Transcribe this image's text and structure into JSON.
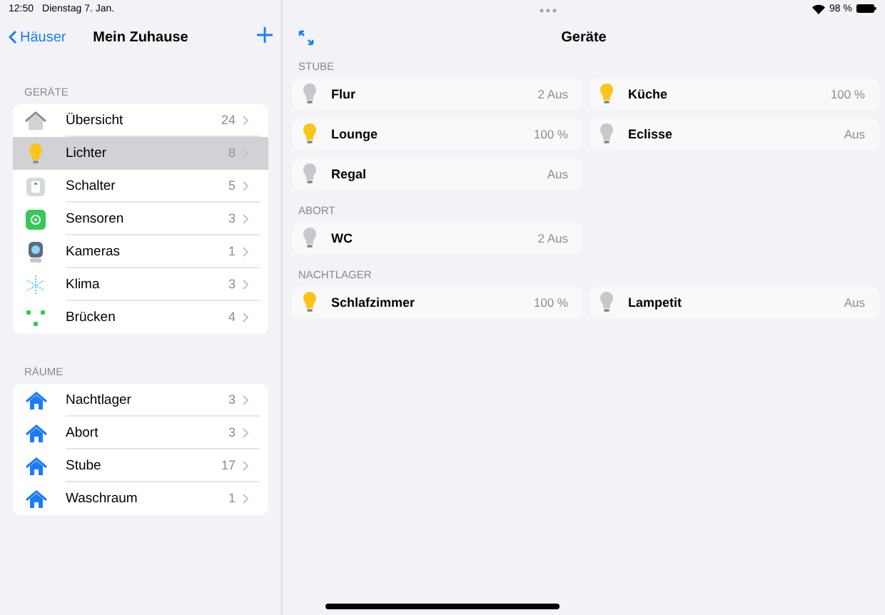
{
  "status_bar": {
    "time": "12:50",
    "date": "Dienstag 7. Jan.",
    "battery": "98 %"
  },
  "sidebar": {
    "back": "Häuser",
    "title": "Mein Zuhause",
    "sections": [
      {
        "header": "GERÄTE",
        "items": [
          {
            "kind": "overview",
            "label": "Übersicht",
            "count": "24",
            "selected": false
          },
          {
            "kind": "light",
            "label": "Lichter",
            "count": "8",
            "selected": true
          },
          {
            "kind": "switch",
            "label": "Schalter",
            "count": "5",
            "selected": false
          },
          {
            "kind": "sensor",
            "label": "Sensoren",
            "count": "3",
            "selected": false
          },
          {
            "kind": "camera",
            "label": "Kameras",
            "count": "1",
            "selected": false
          },
          {
            "kind": "climate",
            "label": "Klima",
            "count": "3",
            "selected": false
          },
          {
            "kind": "bridge",
            "label": "Brücken",
            "count": "4",
            "selected": false
          }
        ]
      },
      {
        "header": "RÄUME",
        "items": [
          {
            "kind": "room",
            "label": "Nachtlager",
            "count": "3",
            "selected": false
          },
          {
            "kind": "room",
            "label": "Abort",
            "count": "3",
            "selected": false
          },
          {
            "kind": "room",
            "label": "Stube",
            "count": "17",
            "selected": false
          },
          {
            "kind": "room",
            "label": "Waschraum",
            "count": "1",
            "selected": false
          }
        ]
      }
    ]
  },
  "detail": {
    "title": "Geräte",
    "groups": [
      {
        "header": "STUBE",
        "tiles": [
          {
            "name": "Flur",
            "status": "2 Aus",
            "on": false
          },
          {
            "name": "Küche",
            "status": "100 %",
            "on": true
          },
          {
            "name": "Lounge",
            "status": "100 %",
            "on": true
          },
          {
            "name": "Eclisse",
            "status": "Aus",
            "on": false
          },
          {
            "name": "Regal",
            "status": "Aus",
            "on": false
          }
        ]
      },
      {
        "header": "ABORT",
        "tiles": [
          {
            "name": "WC",
            "status": "2 Aus",
            "on": false
          }
        ]
      },
      {
        "header": "NACHTLAGER",
        "tiles": [
          {
            "name": "Schlafzimmer",
            "status": "100 %",
            "on": true
          },
          {
            "name": "Lampetit",
            "status": "Aus",
            "on": false
          }
        ]
      }
    ]
  }
}
